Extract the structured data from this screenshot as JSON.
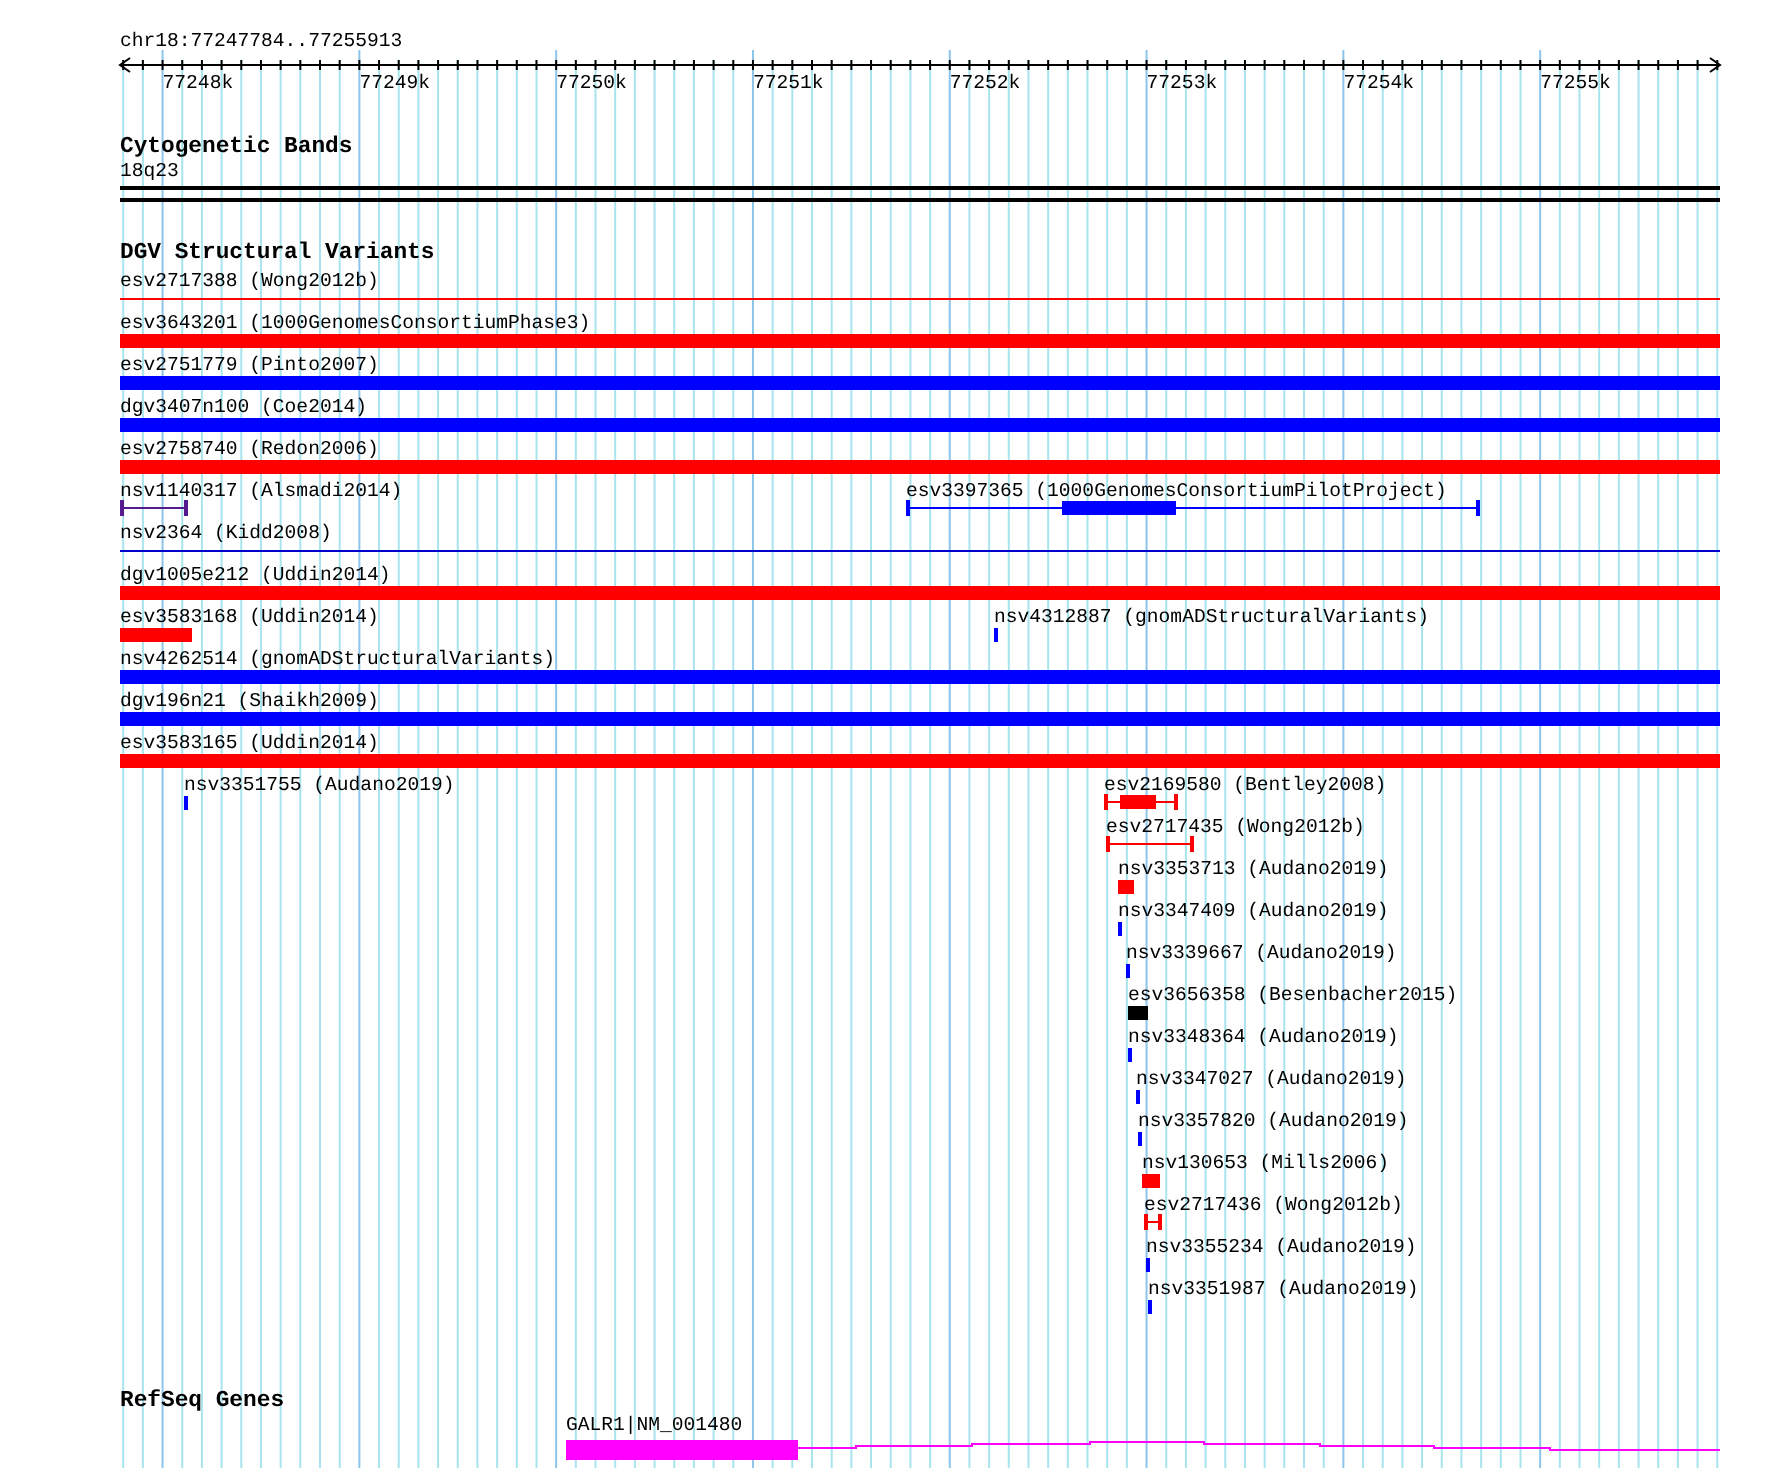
{
  "ruler": {
    "locus": "chr18:77247784..77255913",
    "ticks": [
      "77248k",
      "77249k",
      "77250k",
      "77251k",
      "77252k",
      "77253k",
      "77254k",
      "77255k"
    ]
  },
  "cytobands": {
    "title": "Cytogenetic Bands",
    "band": "18q23"
  },
  "dgv": {
    "title": "DGV Structural Variants",
    "rows": [
      {
        "features": [
          {
            "label": "esv2717388 (Wong2012b)",
            "kind": "line",
            "color": "#ff0000"
          }
        ]
      },
      {
        "features": [
          {
            "label": "esv3643201 (1000GenomesConsortiumPhase3)",
            "kind": "bar",
            "color": "#ff0000"
          }
        ]
      },
      {
        "features": [
          {
            "label": "esv2751779 (Pinto2007)",
            "kind": "bar",
            "color": "#0000ff"
          }
        ]
      },
      {
        "features": [
          {
            "label": "dgv3407n100 (Coe2014)",
            "kind": "bar",
            "color": "#0000ff"
          }
        ]
      },
      {
        "features": [
          {
            "label": "esv2758740 (Redon2006)",
            "kind": "bar",
            "color": "#ff0000"
          }
        ]
      },
      {
        "features": [
          {
            "label": "nsv1140317 (Alsmadi2014)",
            "kind": "range",
            "color": "#551a8b"
          },
          {
            "label": "esv3397365 (1000GenomesConsortiumPilotProject)",
            "kind": "range",
            "color": "#0000ff"
          }
        ]
      },
      {
        "features": [
          {
            "label": "nsv2364 (Kidd2008)",
            "kind": "line",
            "color": "#0000cc"
          }
        ]
      },
      {
        "features": [
          {
            "label": "dgv1005e212 (Uddin2014)",
            "kind": "bar",
            "color": "#ff0000"
          }
        ]
      },
      {
        "features": [
          {
            "label": "esv3583168 (Uddin2014)",
            "kind": "bar",
            "color": "#ff0000"
          },
          {
            "label": "nsv4312887 (gnomADStructuralVariants)",
            "kind": "bar",
            "color": "#0000ff"
          }
        ]
      },
      {
        "features": [
          {
            "label": "nsv4262514 (gnomADStructuralVariants)",
            "kind": "bar",
            "color": "#0000ff"
          }
        ]
      },
      {
        "features": [
          {
            "label": "dgv196n21 (Shaikh2009)",
            "kind": "bar",
            "color": "#0000ff"
          }
        ]
      },
      {
        "features": [
          {
            "label": "esv3583165 (Uddin2014)",
            "kind": "bar",
            "color": "#ff0000"
          }
        ]
      },
      {
        "features": [
          {
            "label": "nsv3351755 (Audano2019)",
            "kind": "bar",
            "color": "#0000ff"
          },
          {
            "label": "esv2169580 (Bentley2008)",
            "kind": "range",
            "color": "#ff0000"
          }
        ]
      },
      {
        "features": [
          {
            "label": "esv2717435 (Wong2012b)",
            "kind": "range",
            "color": "#ff0000"
          }
        ]
      },
      {
        "features": [
          {
            "label": "nsv3353713 (Audano2019)",
            "kind": "bar",
            "color": "#ff0000"
          }
        ]
      },
      {
        "features": [
          {
            "label": "nsv3347409 (Audano2019)",
            "kind": "bar",
            "color": "#0000ff"
          }
        ]
      },
      {
        "features": [
          {
            "label": "nsv3339667 (Audano2019)",
            "kind": "bar",
            "color": "#0000ff"
          }
        ]
      },
      {
        "features": [
          {
            "label": "esv3656358 (Besenbacher2015)",
            "kind": "bar",
            "color": "#000000"
          }
        ]
      },
      {
        "features": [
          {
            "label": "nsv3348364 (Audano2019)",
            "kind": "bar",
            "color": "#0000ff"
          }
        ]
      },
      {
        "features": [
          {
            "label": "nsv3347027 (Audano2019)",
            "kind": "bar",
            "color": "#0000ff"
          }
        ]
      },
      {
        "features": [
          {
            "label": "nsv3357820 (Audano2019)",
            "kind": "bar",
            "color": "#0000ff"
          }
        ]
      },
      {
        "features": [
          {
            "label": "nsv130653 (Mills2006)",
            "kind": "bar",
            "color": "#ff0000"
          }
        ]
      },
      {
        "features": [
          {
            "label": "esv2717436 (Wong2012b)",
            "kind": "range",
            "color": "#ff0000"
          }
        ]
      },
      {
        "features": [
          {
            "label": "nsv3355234 (Audano2019)",
            "kind": "bar",
            "color": "#0000ff"
          }
        ]
      },
      {
        "features": [
          {
            "label": "nsv3351987 (Audano2019)",
            "kind": "bar",
            "color": "#0000ff"
          }
        ]
      }
    ]
  },
  "refseq": {
    "title": "RefSeq Genes",
    "gene": "GALR1|NM_001480"
  }
}
